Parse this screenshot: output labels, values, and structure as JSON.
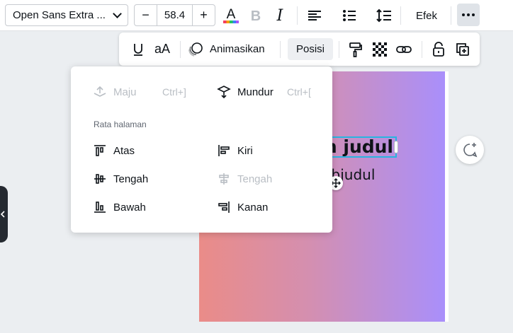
{
  "toolbar": {
    "font_name": "Open Sans Extra ...",
    "font_size": "58.4",
    "minus": "−",
    "plus": "+",
    "italic": "I",
    "effects": "Efek",
    "text_color": "#000000"
  },
  "subtoolbar": {
    "case": "aA",
    "animate": "Animasikan",
    "position": "Posisi"
  },
  "position_menu": {
    "forward": {
      "label": "Maju",
      "shortcut": "Ctrl+]"
    },
    "backward": {
      "label": "Mundur",
      "shortcut": "Ctrl+["
    },
    "section_title": "Rata halaman",
    "align": {
      "top": "Atas",
      "left": "Kiri",
      "middle": "Tengah",
      "center": "Tengah",
      "bottom": "Bawah",
      "right": "Kanan"
    }
  },
  "canvas": {
    "heading_text": "an judul",
    "subheading_text": "ıbjudul",
    "gradient": [
      "#ea8c88",
      "#a98ffb"
    ]
  },
  "colors": {
    "selection": "#28b4e0",
    "disabled": "#b9bec4"
  }
}
